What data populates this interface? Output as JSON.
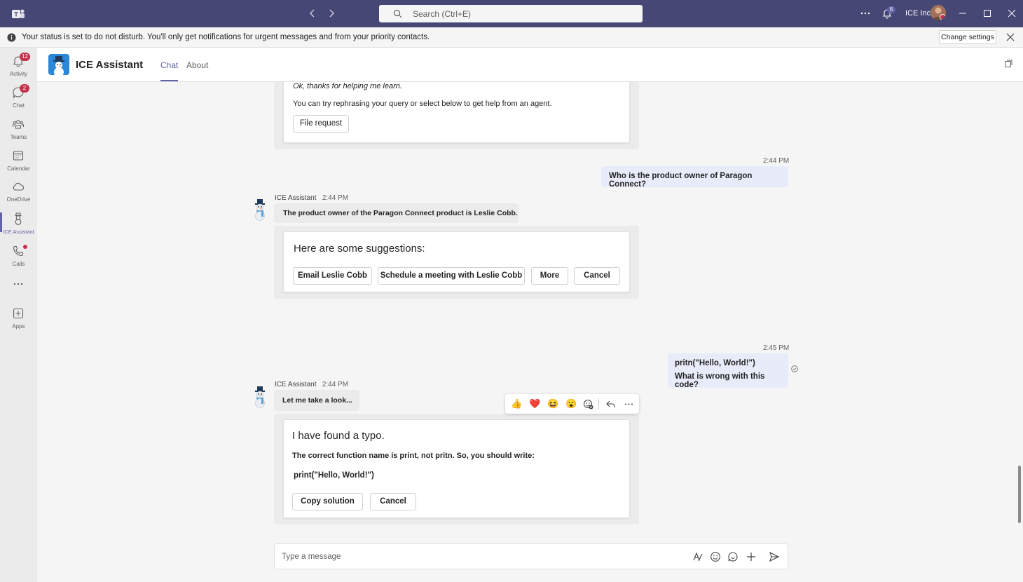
{
  "titlebar": {
    "search_placeholder": "Search (Ctrl+E)",
    "notification_count": "6",
    "org_name": "ICE Inc."
  },
  "notification_bar": {
    "text": "Your status is set to do not disturb. You'll only get notifications for urgent messages and from your priority contacts.",
    "button": "Change settings"
  },
  "rail": {
    "items": [
      {
        "label": "Activity",
        "icon": "bell-icon",
        "badge": "12"
      },
      {
        "label": "Chat",
        "icon": "chat-icon",
        "badge": "2"
      },
      {
        "label": "Teams",
        "icon": "teams-icon"
      },
      {
        "label": "Calendar",
        "icon": "calendar-icon"
      },
      {
        "label": "OneDrive",
        "icon": "cloud-icon"
      },
      {
        "label": "ICE Assistant",
        "icon": "snowman-icon",
        "active": true
      },
      {
        "label": "Calls",
        "icon": "phone-icon",
        "dot": true
      },
      {
        "label": "...",
        "icon": "more-icon"
      },
      {
        "label": "Apps",
        "icon": "apps-icon"
      }
    ]
  },
  "header": {
    "app_name": "ICE Assistant",
    "tabs": [
      {
        "label": "Chat",
        "active": true
      },
      {
        "label": "About",
        "active": false
      }
    ]
  },
  "messages": {
    "card0": {
      "line1": "Ok, thanks for helping me learn.",
      "line2": "You can try rephrasing your query or select below to get help from an agent.",
      "button": "File request"
    },
    "user1": {
      "time": "2:44 PM",
      "text": "Who is the product owner of Paragon Connect?"
    },
    "bot1": {
      "sender": "ICE Assistant",
      "time": "2:44 PM",
      "text": "The product owner of the Paragon Connect product is Leslie Cobb.",
      "card_title": "Here are some suggestions:",
      "buttons": [
        "Email Leslie Cobb",
        "Schedule a meeting with Leslie Cobb",
        "More",
        "Cancel"
      ]
    },
    "user2": {
      "time": "2:45 PM",
      "line1": "pritn(\"Hello, World!\")",
      "line2": "What is wrong with this code?"
    },
    "bot2": {
      "sender": "ICE Assistant",
      "time": "2:44 PM",
      "text": "Let me take a look...",
      "card_title": "I have found a typo.",
      "card_body": "The correct function name is print, not pritn. So, you should write:",
      "card_code": "print(\"Hello, World!\")",
      "buttons": [
        "Copy solution",
        "Cancel"
      ]
    },
    "reactions": [
      "👍",
      "❤️",
      "😆",
      "😮"
    ]
  },
  "compose": {
    "placeholder": "Type a message"
  },
  "colors": {
    "brand": "#464775",
    "accent": "#6264a7",
    "badge": "#c4314b",
    "user_bubble": "#e8ebfa"
  }
}
